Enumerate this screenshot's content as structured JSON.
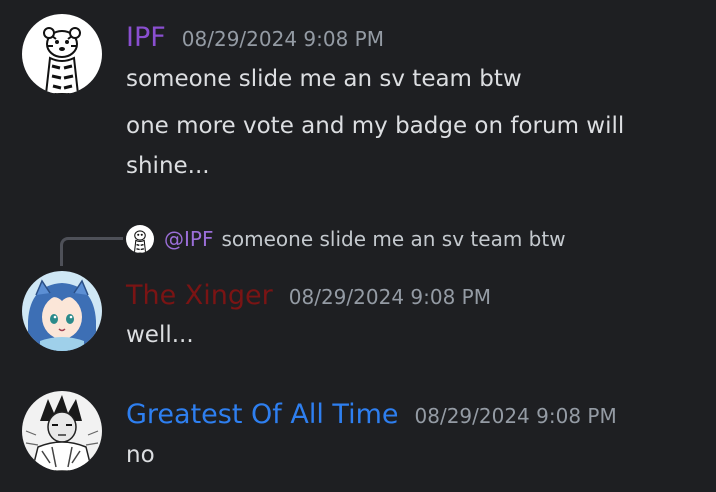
{
  "messages": [
    {
      "username": "IPF",
      "username_color": "#8a4fd0",
      "timestamp": "08/29/2024 9:08 PM",
      "avatar_icon": "tiger-avatar-icon",
      "lines": [
        "someone slide me an sv team btw",
        "one more vote and my badge on forum will shine..."
      ]
    },
    {
      "reply": {
        "mention": "@IPF",
        "text": "someone slide me an sv team btw",
        "avatar_icon": "tiger-avatar-icon"
      },
      "username": "The Xinger",
      "username_color": "#7a1414",
      "timestamp": "08/29/2024 9:08 PM",
      "avatar_icon": "anime-girl-avatar-icon",
      "lines": [
        "well..."
      ]
    },
    {
      "username": "Greatest Of All Time",
      "username_color": "#2e7ff0",
      "timestamp": "08/29/2024 9:08 PM",
      "avatar_icon": "manga-character-avatar-icon",
      "lines": [
        "no"
      ]
    }
  ],
  "colors": {
    "background": "#1e1f22",
    "text": "#dcdee1",
    "timestamp": "#949ba4",
    "mention": "#9b6ed8"
  }
}
